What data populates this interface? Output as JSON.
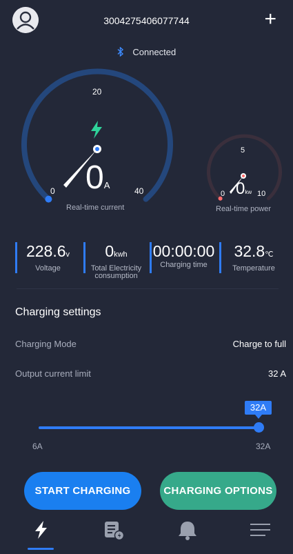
{
  "header": {
    "device_id": "3004275406077744",
    "connection_status": "Connected",
    "avatar_icon": "user-avatar-icon",
    "add_icon": "plus-icon"
  },
  "current_gauge": {
    "value": "0",
    "unit": "A",
    "scale_min": "0",
    "scale_mid": "20",
    "scale_max": "40",
    "caption": "Real-time current",
    "icon": "lightning-bolt-icon",
    "level": 0
  },
  "power_gauge": {
    "value": "0",
    "unit": "kw",
    "scale_min": "0",
    "scale_mid": "5",
    "scale_max": "10",
    "caption": "Real-time power",
    "level": 0
  },
  "stats": [
    {
      "value": "228.6",
      "unit": "v",
      "label": "Voltage"
    },
    {
      "value": "0",
      "unit": "kwh",
      "label": "Total Electricity consumption"
    },
    {
      "value": "00:00:00",
      "unit": "",
      "label": "Charging time"
    },
    {
      "value": "32.8",
      "unit": "℃",
      "label": "Temperature"
    }
  ],
  "settings": {
    "title": "Charging settings",
    "mode_label": "Charging Mode",
    "mode_value": "Charge to full",
    "limit_label": "Output current limit",
    "limit_value": "32 A"
  },
  "slider": {
    "value_label": "32A",
    "min_label": "6A",
    "max_label": "32A",
    "level": 1.0
  },
  "buttons": {
    "start": "START CHARGING",
    "options": "CHARGING OPTIONS"
  },
  "nav": {
    "items": [
      "charging-nav-icon",
      "records-nav-icon",
      "alarm-nav-icon",
      "menu-nav-icon"
    ],
    "active": 0
  },
  "colors": {
    "background": "#232838",
    "accent_blue": "#2f7cf6",
    "accent_green": "#36a98a",
    "bolt_green": "#2fd39a",
    "power_needle_red": "#ff6b6b"
  }
}
